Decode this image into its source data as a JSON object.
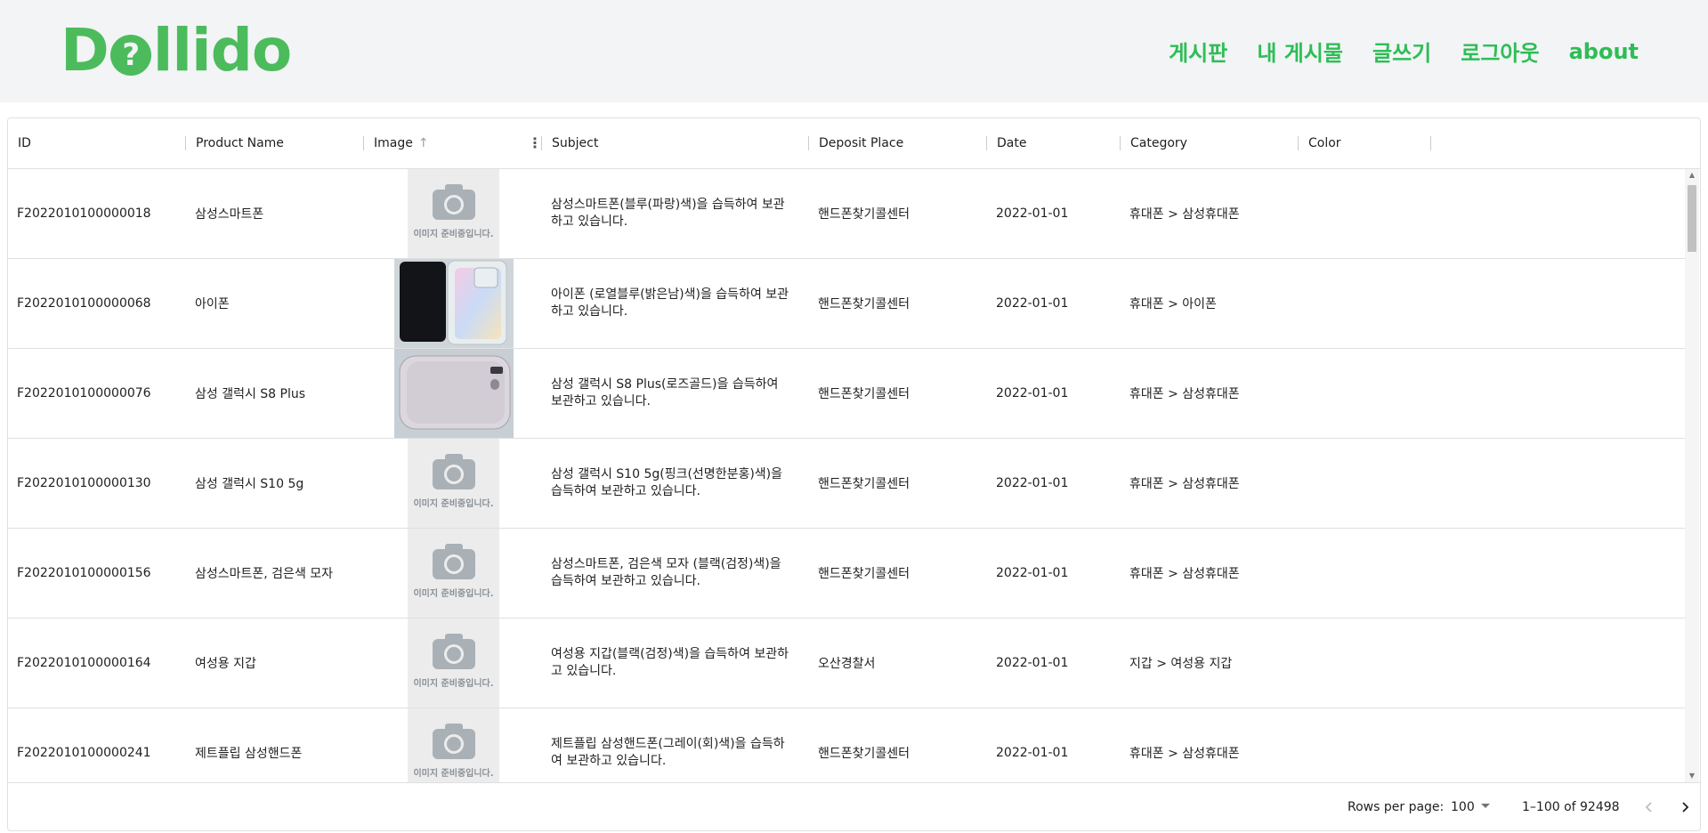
{
  "header": {
    "logo_text_start": "D",
    "logo_mark": "?",
    "logo_text_end": "llido",
    "nav": [
      "게시판",
      "내 게시물",
      "글쓰기",
      "로그아웃",
      "about"
    ],
    "brand_color": "#4cbb5c"
  },
  "columns": [
    "ID",
    "Product Name",
    "Image",
    "Subject",
    "Deposit Place",
    "Date",
    "Category",
    "Color"
  ],
  "image_placeholder_text": "이미지 준비중입니다.",
  "rows": [
    {
      "id": "F2022010100000018",
      "product": "삼성스마트폰",
      "image": "placeholder",
      "subject": "삼성스마트폰(블루(파랑)색)을 습득하여 보관하고 있습니다.",
      "place": "핸드폰찾기콜센터",
      "date": "2022-01-01",
      "category": "휴대폰 > 삼성휴대폰",
      "color": ""
    },
    {
      "id": "F2022010100000068",
      "product": "아이폰",
      "image": "photo-iphone",
      "subject": "아이폰 (로열블루(밝은남)색)을 습득하여 보관하고 있습니다.",
      "place": "핸드폰찾기콜센터",
      "date": "2022-01-01",
      "category": "휴대폰 > 아이폰",
      "color": ""
    },
    {
      "id": "F2022010100000076",
      "product": "삼성 갤럭시 S8 Plus",
      "image": "photo-galaxy",
      "subject": "삼성 갤럭시 S8 Plus(로즈골드)을 습득하여 보관하고 있습니다.",
      "place": "핸드폰찾기콜센터",
      "date": "2022-01-01",
      "category": "휴대폰 > 삼성휴대폰",
      "color": ""
    },
    {
      "id": "F2022010100000130",
      "product": "삼성 갤럭시 S10 5g",
      "image": "placeholder",
      "subject": "삼성 갤럭시 S10 5g(핑크(선명한분홍)색)을 습득하여 보관하고 있습니다.",
      "place": "핸드폰찾기콜센터",
      "date": "2022-01-01",
      "category": "휴대폰 > 삼성휴대폰",
      "color": ""
    },
    {
      "id": "F2022010100000156",
      "product": "삼성스마트폰, 검은색 모자",
      "image": "placeholder",
      "subject": "삼성스마트폰, 검은색 모자 (블랙(검정)색)을 습득하여 보관하고 있습니다.",
      "place": "핸드폰찾기콜센터",
      "date": "2022-01-01",
      "category": "휴대폰 > 삼성휴대폰",
      "color": ""
    },
    {
      "id": "F2022010100000164",
      "product": "여성용 지갑",
      "image": "placeholder",
      "subject": "여성용 지갑(블랙(검정)색)을 습득하여 보관하고 있습니다.",
      "place": "오산경찰서",
      "date": "2022-01-01",
      "category": "지갑 > 여성용 지갑",
      "color": ""
    },
    {
      "id": "F2022010100000241",
      "product": "제트플립 삼성핸드폰",
      "image": "placeholder",
      "subject": "제트플립 삼성핸드폰(그레이(회)색)을 습득하여 보관하고 있습니다.",
      "place": "핸드폰찾기콜센터",
      "date": "2022-01-01",
      "category": "휴대폰 > 삼성휴대폰",
      "color": ""
    }
  ],
  "footer": {
    "rows_per_page_label": "Rows per page:",
    "rows_per_page_value": "100",
    "range": "1–100 of 92498"
  }
}
